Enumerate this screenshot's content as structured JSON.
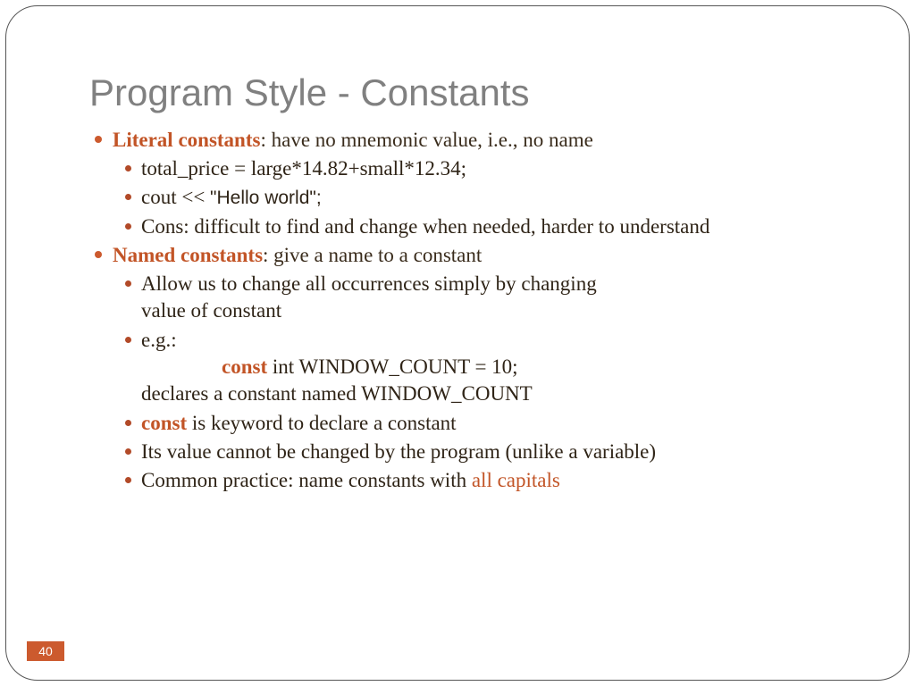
{
  "title": "Program Style - Constants",
  "page_number": "40",
  "b1": {
    "heading": "Literal constants",
    "heading_tail": ":  have no mnemonic value, i.e., no name",
    "sub": {
      "a": "total_price = large*14.82+small*12.34;",
      "b_pre": "cout << ",
      "b_quote": "\"Hello world\";",
      "c": "Cons:  difficult to find and change when needed, harder to understand"
    }
  },
  "b2": {
    "heading": "Named constants",
    "heading_tail": ": give a name to a constant",
    "sub": {
      "a": "Allow us to change all occurrences simply by changing value of constant",
      "b_pre": "e.g.:",
      "b_kw": "const",
      "b_code_rest": " int WINDOW_COUNT = 10;",
      "b_post": "declares a constant named WINDOW_COUNT",
      "c_kw": "const",
      "c_rest": " is keyword to declare a constant",
      "d": "Its value cannot be changed by the program (unlike a variable)",
      "e_pre": "Common practice:  name constants with ",
      "e_orange": "all capitals"
    }
  }
}
